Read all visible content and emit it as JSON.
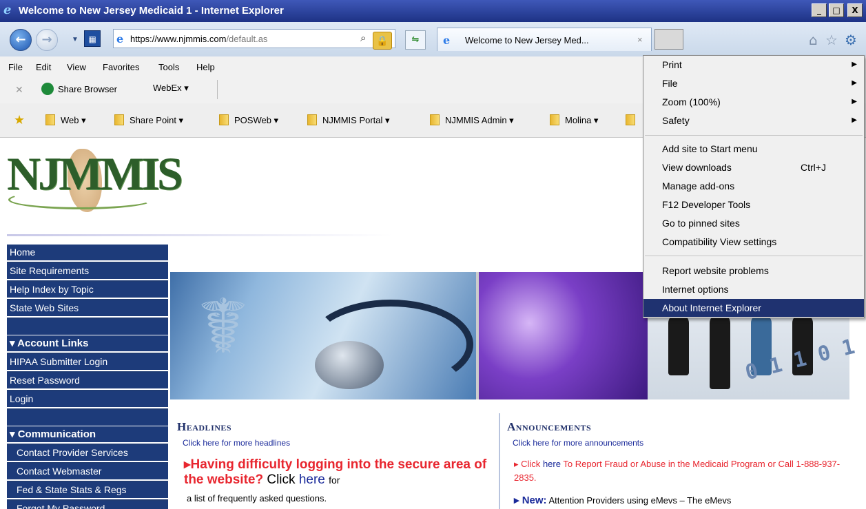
{
  "window": {
    "title": "Welcome to New Jersey Medicaid 1 - Internet Explorer",
    "buttons": [
      "_",
      "□",
      "X"
    ]
  },
  "address_bar": {
    "url_prefix": "https://",
    "url_domain": "www.njmmis.com",
    "url_path": "/default.as"
  },
  "tab": {
    "title": "Welcome to New Jersey Med...",
    "close": "×"
  },
  "menu_bar": [
    "File",
    "Edit",
    "View",
    "Favorites",
    "Tools",
    "Help"
  ],
  "command_bar": {
    "share": "Share Browser",
    "webex": "WebEx ▾"
  },
  "favorites_bar": [
    "Web ▾",
    "Share Point ▾",
    "POSWeb ▾",
    "NJMMIS Portal ▾",
    "NJMMIS Admin ▾",
    "Molina ▾"
  ],
  "logo": {
    "text": "NJMMIS"
  },
  "sidebar": {
    "items": [
      "Home",
      "Site Requirements",
      "Help Index by Topic",
      "State Web Sites",
      "",
      "▾ Account Links",
      "HIPAA Submitter Login",
      "Reset Password",
      "Login",
      "",
      "▾ Communication",
      "Contact Provider Services",
      "Contact Webmaster",
      "Fed & State Stats & Regs",
      "Forgot My Password"
    ]
  },
  "headlines": {
    "title": "Headlines",
    "more": "Click here for more headlines",
    "item_red": "▸Having difficulty logging into the secure area of the website?",
    "item_click": "Click",
    "item_here": "here",
    "item_for": "for",
    "item_tail": "a list of frequently asked questions."
  },
  "announcements": {
    "title": "Announcements",
    "more": "Click here for more announcements",
    "item1_pre": "▸ Click",
    "item1_here": "here",
    "item1_rest": "To Report Fraud or Abuse in the Medicaid Program or Call 1-888-937-2835.",
    "item2_new": "▸ New:",
    "item2_rest": "Attention Providers using eMevs – The eMevs"
  },
  "tools_menu": {
    "items": [
      {
        "label": "Print",
        "arrow": "▶"
      },
      {
        "label": "File",
        "arrow": "▶"
      },
      {
        "label": "Zoom (100%)",
        "arrow": "▶"
      },
      {
        "label": "Safety",
        "arrow": "▶"
      },
      {
        "label": "Add site to Start menu"
      },
      {
        "label": "View downloads",
        "shortcut": "Ctrl+J"
      },
      {
        "label": "Manage add-ons"
      },
      {
        "label": "F12 Developer Tools"
      },
      {
        "label": "Go to pinned sites"
      },
      {
        "label": "Compatibility View settings"
      },
      {
        "label": "Report website problems"
      },
      {
        "label": "Internet options"
      },
      {
        "label": "About Internet Explorer"
      }
    ],
    "selected": "About Internet Explorer"
  },
  "colors": {
    "sidebar_bg": "#1d3b7a",
    "menu_selected": "#1f3270",
    "headline_red": "#e8262f",
    "link_blue": "#1a2a9a"
  }
}
